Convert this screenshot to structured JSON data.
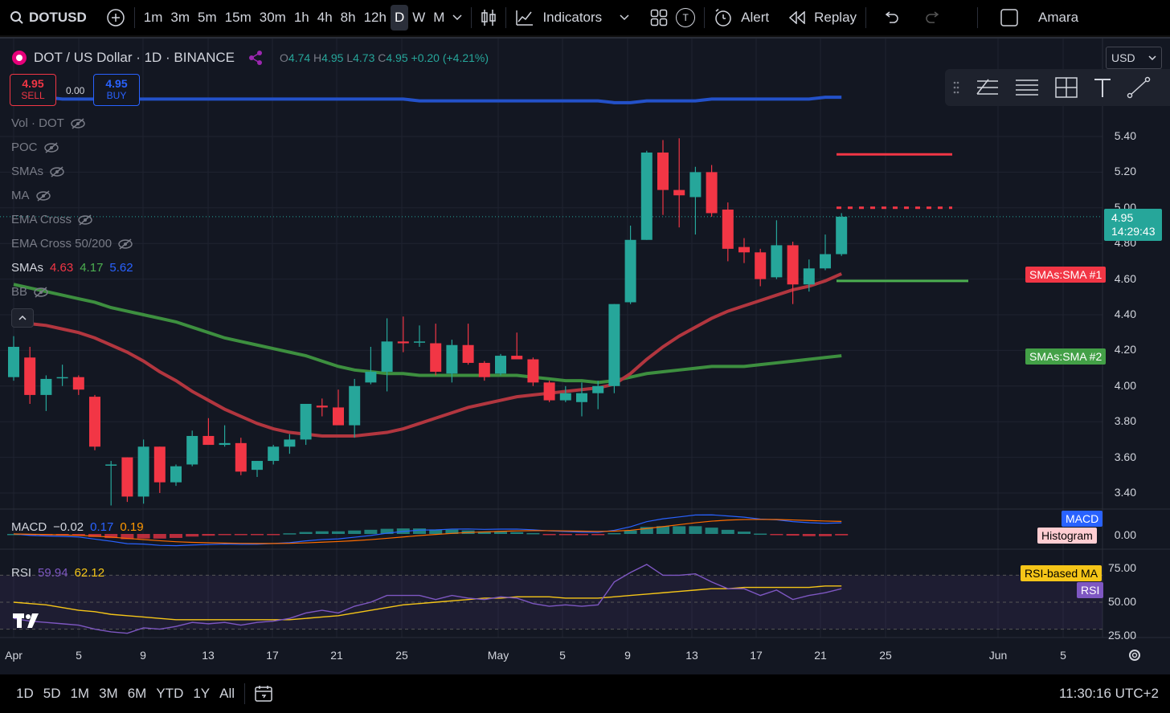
{
  "topbar": {
    "symbol": "DOTUSD",
    "intervals": [
      "1m",
      "3m",
      "5m",
      "15m",
      "30m",
      "1h",
      "4h",
      "8h",
      "12h",
      "D",
      "W",
      "M"
    ],
    "selected_interval": "D",
    "indicators_label": "Indicators",
    "t_badge": "T",
    "alert_label": "Alert",
    "replay_label": "Replay",
    "user_label": "Amara"
  },
  "header": {
    "title": "DOT / US Dollar · 1D · BINANCE",
    "o_label": "O",
    "o": "4.74",
    "h_label": "H",
    "h": "4.95",
    "l_label": "L",
    "l": "4.73",
    "c_label": "C",
    "c": "4.95",
    "change": "+0.20 (+4.21%)",
    "currency": "USD"
  },
  "trade": {
    "sell_price": "4.95",
    "sell_label": "SELL",
    "spread": "0.00",
    "buy_price": "4.95",
    "buy_label": "BUY"
  },
  "legend": {
    "hidden": [
      "Vol · DOT",
      "POC",
      "SMAs",
      "MA",
      "EMA Cross",
      "EMA Cross 50/200"
    ],
    "smas_label": "SMAs",
    "sma1": "4.63",
    "sma2": "4.17",
    "sma3": "5.62",
    "bb_label": "BB"
  },
  "price_axis": [
    "5.40",
    "5.20",
    "5.00",
    "4.80",
    "4.60",
    "4.40",
    "4.20",
    "4.00",
    "3.80",
    "3.60",
    "3.40"
  ],
  "last_price": {
    "value": "4.95",
    "countdown": "14:29:43"
  },
  "tags": {
    "sma1": "SMAs:SMA #1",
    "sma2": "SMAs:SMA #2",
    "macd": "MACD",
    "histogram": "Histogram",
    "rsi_ma": "RSI-based MA",
    "rsi": "RSI"
  },
  "macd": {
    "label": "MACD",
    "v1": "−0.02",
    "v2": "0.17",
    "v3": "0.19",
    "axis": "0.00"
  },
  "rsi": {
    "label": "RSI",
    "v1": "59.94",
    "v2": "62.12",
    "axis": [
      "75.00",
      "50.00",
      "25.00"
    ]
  },
  "time_axis": [
    "Apr",
    "5",
    "9",
    "13",
    "17",
    "21",
    "25",
    "May",
    "5",
    "9",
    "13",
    "17",
    "21",
    "25",
    "Jun",
    "5"
  ],
  "bottombar": {
    "ranges": [
      "1D",
      "5D",
      "1M",
      "3M",
      "6M",
      "YTD",
      "1Y",
      "All"
    ],
    "clock": "11:30:16 UTC+2"
  },
  "colors": {
    "up": "#26a69a",
    "down": "#f23645",
    "sma1": "#b2363f",
    "sma2": "#3d8f3f",
    "sma3": "#2351c9",
    "macd": "#2962ff",
    "signal": "#ff6d00",
    "rsi": "#7e57c2",
    "rsi_ma": "#f5c518"
  },
  "chart_data": {
    "type": "candlestick",
    "candles": [
      {
        "o": 4.05,
        "h": 4.28,
        "l": 4.03,
        "c": 4.22
      },
      {
        "o": 4.16,
        "h": 4.22,
        "l": 3.9,
        "c": 3.95
      },
      {
        "o": 3.95,
        "h": 4.06,
        "l": 3.86,
        "c": 4.04
      },
      {
        "o": 4.05,
        "h": 4.12,
        "l": 4.0,
        "c": 4.05
      },
      {
        "o": 4.05,
        "h": 4.06,
        "l": 3.95,
        "c": 3.98
      },
      {
        "o": 3.94,
        "h": 3.95,
        "l": 3.64,
        "c": 3.66
      },
      {
        "o": 3.56,
        "h": 3.58,
        "l": 3.33,
        "c": 3.56
      },
      {
        "o": 3.6,
        "h": 3.6,
        "l": 3.35,
        "c": 3.38
      },
      {
        "o": 3.38,
        "h": 3.7,
        "l": 3.34,
        "c": 3.66
      },
      {
        "o": 3.66,
        "h": 3.66,
        "l": 3.4,
        "c": 3.46
      },
      {
        "o": 3.46,
        "h": 3.56,
        "l": 3.44,
        "c": 3.55
      },
      {
        "o": 3.56,
        "h": 3.75,
        "l": 3.55,
        "c": 3.72
      },
      {
        "o": 3.72,
        "h": 3.82,
        "l": 3.68,
        "c": 3.67
      },
      {
        "o": 3.67,
        "h": 3.78,
        "l": 3.66,
        "c": 3.68
      },
      {
        "o": 3.68,
        "h": 3.71,
        "l": 3.5,
        "c": 3.52
      },
      {
        "o": 3.53,
        "h": 3.58,
        "l": 3.49,
        "c": 3.58
      },
      {
        "o": 3.58,
        "h": 3.67,
        "l": 3.56,
        "c": 3.66
      },
      {
        "o": 3.66,
        "h": 3.73,
        "l": 3.62,
        "c": 3.7
      },
      {
        "o": 3.7,
        "h": 3.9,
        "l": 3.67,
        "c": 3.9
      },
      {
        "o": 3.89,
        "h": 3.93,
        "l": 3.83,
        "c": 3.88
      },
      {
        "o": 3.88,
        "h": 3.98,
        "l": 3.79,
        "c": 3.78
      },
      {
        "o": 3.78,
        "h": 4.04,
        "l": 3.71,
        "c": 4.0
      },
      {
        "o": 4.02,
        "h": 4.22,
        "l": 4.01,
        "c": 4.08
      },
      {
        "o": 4.08,
        "h": 4.38,
        "l": 3.97,
        "c": 4.25
      },
      {
        "o": 4.25,
        "h": 4.39,
        "l": 4.19,
        "c": 4.24
      },
      {
        "o": 4.25,
        "h": 4.34,
        "l": 4.22,
        "c": 4.25
      },
      {
        "o": 4.24,
        "h": 4.35,
        "l": 4.06,
        "c": 4.08
      },
      {
        "o": 4.07,
        "h": 4.26,
        "l": 4.02,
        "c": 4.23
      },
      {
        "o": 4.23,
        "h": 4.35,
        "l": 4.12,
        "c": 4.13
      },
      {
        "o": 4.13,
        "h": 4.14,
        "l": 4.03,
        "c": 4.05
      },
      {
        "o": 4.07,
        "h": 4.18,
        "l": 4.06,
        "c": 4.17
      },
      {
        "o": 4.17,
        "h": 4.3,
        "l": 4.15,
        "c": 4.15
      },
      {
        "o": 4.15,
        "h": 4.16,
        "l": 4.0,
        "c": 4.02
      },
      {
        "o": 4.02,
        "h": 4.03,
        "l": 3.91,
        "c": 3.92
      },
      {
        "o": 3.92,
        "h": 4.0,
        "l": 3.91,
        "c": 3.96
      },
      {
        "o": 3.91,
        "h": 4.02,
        "l": 3.83,
        "c": 3.96
      },
      {
        "o": 3.96,
        "h": 4.03,
        "l": 3.87,
        "c": 4.0
      },
      {
        "o": 4.0,
        "h": 4.46,
        "l": 3.96,
        "c": 4.46
      },
      {
        "o": 4.47,
        "h": 4.9,
        "l": 4.46,
        "c": 4.82
      },
      {
        "o": 4.82,
        "h": 5.32,
        "l": 4.82,
        "c": 5.31
      },
      {
        "o": 5.31,
        "h": 5.38,
        "l": 4.96,
        "c": 5.1
      },
      {
        "o": 5.1,
        "h": 5.39,
        "l": 4.89,
        "c": 5.07
      },
      {
        "o": 5.06,
        "h": 5.23,
        "l": 4.85,
        "c": 5.2
      },
      {
        "o": 5.2,
        "h": 5.24,
        "l": 4.95,
        "c": 4.97
      },
      {
        "o": 4.99,
        "h": 5.03,
        "l": 4.7,
        "c": 4.77
      },
      {
        "o": 4.78,
        "h": 4.83,
        "l": 4.69,
        "c": 4.75
      },
      {
        "o": 4.75,
        "h": 4.77,
        "l": 4.56,
        "c": 4.6
      },
      {
        "o": 4.61,
        "h": 4.93,
        "l": 4.6,
        "c": 4.79
      },
      {
        "o": 4.79,
        "h": 4.81,
        "l": 4.46,
        "c": 4.57
      },
      {
        "o": 4.57,
        "h": 4.71,
        "l": 4.53,
        "c": 4.66
      },
      {
        "o": 4.66,
        "h": 4.85,
        "l": 4.65,
        "c": 4.74
      },
      {
        "o": 4.74,
        "h": 4.97,
        "l": 4.73,
        "c": 4.95
      }
    ],
    "sma1": [
      4.36,
      4.35,
      4.34,
      4.32,
      4.3,
      4.27,
      4.23,
      4.19,
      4.14,
      4.08,
      4.03,
      3.97,
      3.92,
      3.87,
      3.83,
      3.79,
      3.76,
      3.74,
      3.73,
      3.72,
      3.72,
      3.72,
      3.73,
      3.74,
      3.76,
      3.79,
      3.82,
      3.85,
      3.88,
      3.9,
      3.92,
      3.94,
      3.95,
      3.96,
      3.97,
      3.98,
      3.99,
      4.01,
      4.07,
      4.15,
      4.22,
      4.28,
      4.33,
      4.38,
      4.42,
      4.45,
      4.48,
      4.51,
      4.54,
      4.56,
      4.59,
      4.63
    ],
    "sma2": [
      4.57,
      4.55,
      4.53,
      4.51,
      4.49,
      4.47,
      4.44,
      4.42,
      4.4,
      4.38,
      4.36,
      4.33,
      4.3,
      4.27,
      4.25,
      4.23,
      4.21,
      4.19,
      4.17,
      4.14,
      4.11,
      4.09,
      4.08,
      4.07,
      4.07,
      4.06,
      4.06,
      4.06,
      4.06,
      4.06,
      4.06,
      4.06,
      4.05,
      4.04,
      4.03,
      4.03,
      4.02,
      4.03,
      4.05,
      4.07,
      4.08,
      4.09,
      4.1,
      4.11,
      4.11,
      4.11,
      4.12,
      4.13,
      4.14,
      4.15,
      4.16,
      4.17
    ],
    "sma3": [
      5.62,
      5.62,
      5.62,
      5.61,
      5.61,
      5.61,
      5.61,
      5.61,
      5.61,
      5.61,
      5.61,
      5.61,
      5.61,
      5.61,
      5.61,
      5.61,
      5.61,
      5.61,
      5.61,
      5.61,
      5.61,
      5.61,
      5.61,
      5.61,
      5.61,
      5.6,
      5.6,
      5.6,
      5.6,
      5.6,
      5.6,
      5.6,
      5.6,
      5.6,
      5.6,
      5.6,
      5.6,
      5.59,
      5.59,
      5.6,
      5.6,
      5.6,
      5.6,
      5.61,
      5.61,
      5.61,
      5.61,
      5.61,
      5.61,
      5.61,
      5.62,
      5.62
    ],
    "levels": {
      "sma1_level": 4.59,
      "sma2_level": 5.3,
      "dotted_level": 5.0
    },
    "rsi": [
      38,
      36,
      35,
      34,
      33,
      30,
      28,
      27,
      31,
      30,
      32,
      35,
      34,
      35,
      33,
      35,
      36,
      38,
      42,
      44,
      42,
      47,
      50,
      55,
      55,
      55,
      52,
      55,
      53,
      52,
      54,
      53,
      49,
      47,
      48,
      47,
      48,
      65,
      72,
      78,
      70,
      70,
      71,
      65,
      60,
      60,
      55,
      59,
      52,
      55,
      57,
      60
    ],
    "rsi_ma": [
      50,
      49,
      48,
      46,
      44,
      43,
      41,
      40,
      39,
      38,
      37,
      37,
      37,
      37,
      37,
      37,
      37,
      37,
      38,
      39,
      40,
      42,
      44,
      46,
      48,
      49,
      50,
      51,
      52,
      53,
      53,
      54,
      54,
      54,
      53,
      53,
      53,
      54,
      55,
      56,
      57,
      58,
      59,
      60,
      60,
      61,
      61,
      61,
      61,
      61,
      62,
      62
    ],
    "price_range": [
      3.3,
      5.6
    ],
    "rsi_range": [
      0,
      100
    ]
  }
}
